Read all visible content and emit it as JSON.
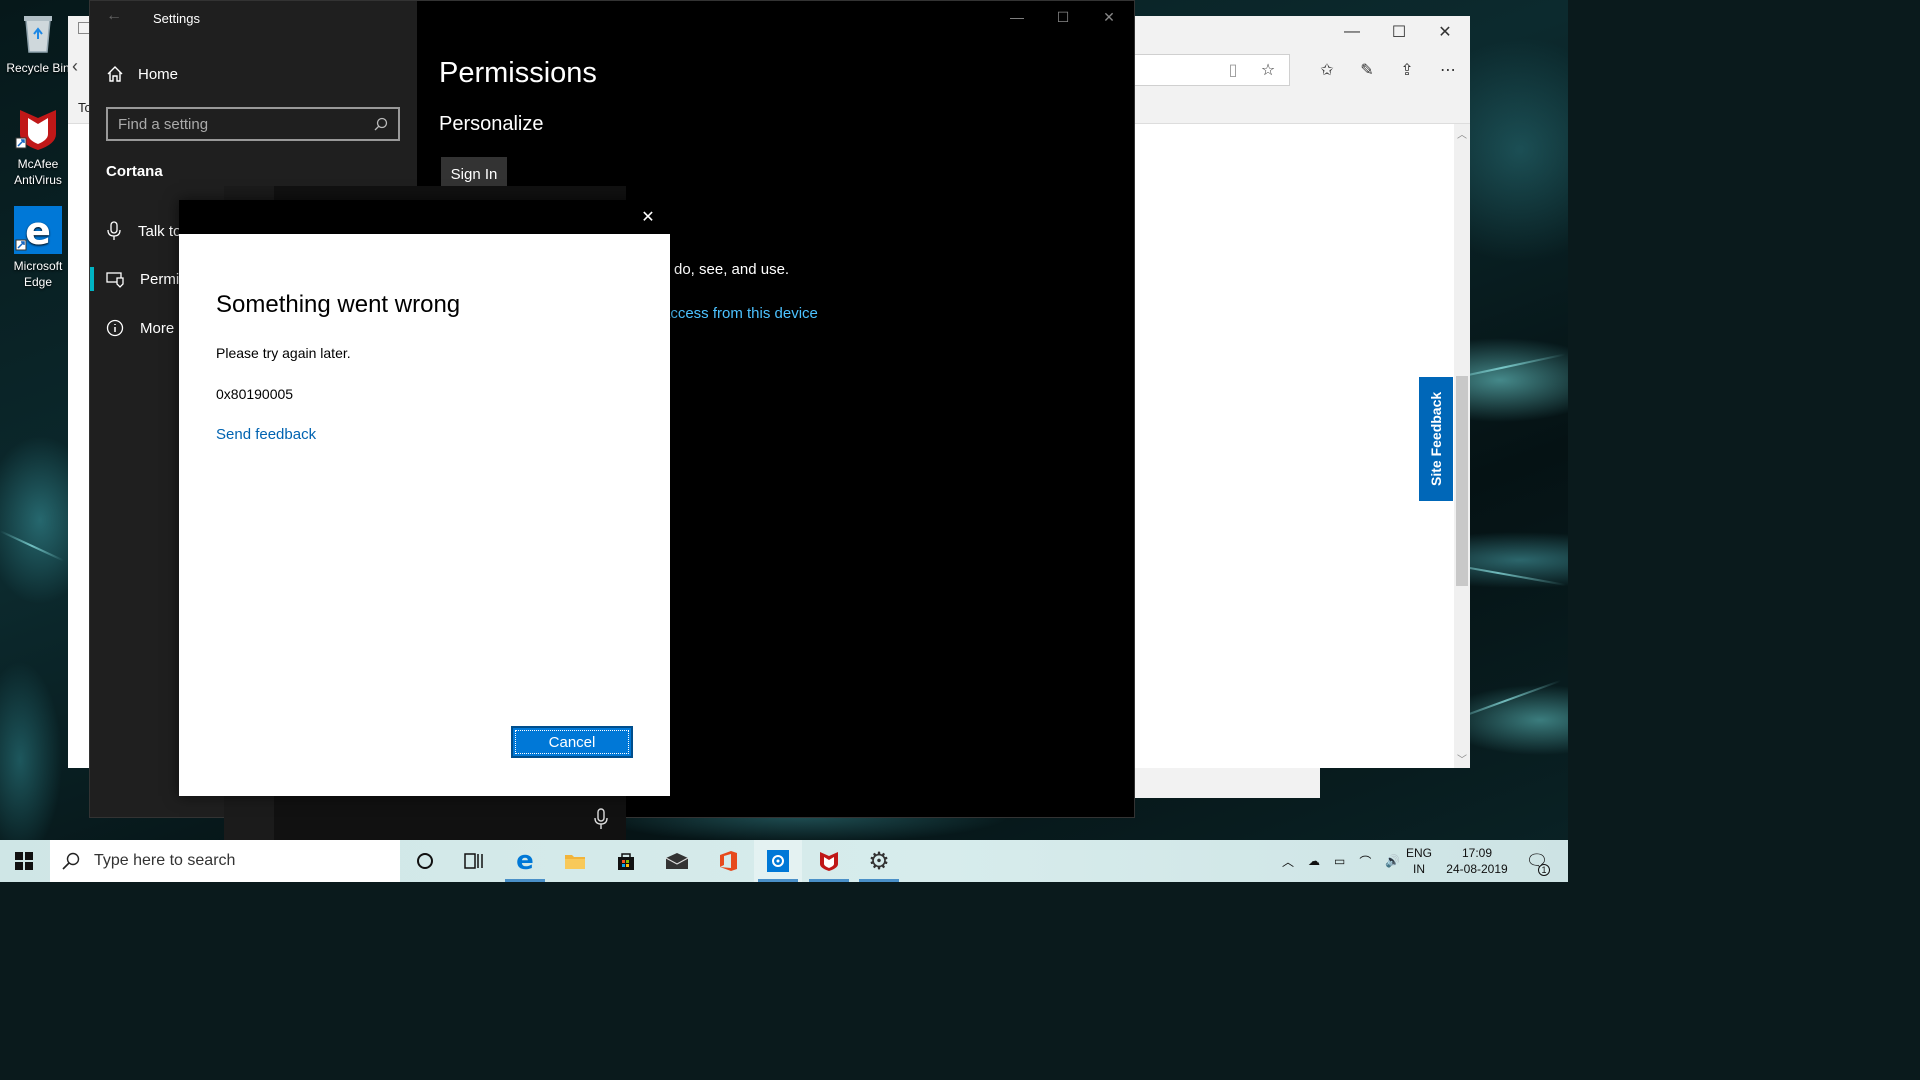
{
  "desktop": {
    "icons": [
      {
        "label": "Recycle Bin"
      },
      {
        "label": "McAfee AntiVirus"
      },
      {
        "label": "Microsoft Edge"
      }
    ]
  },
  "edge": {
    "tab_fragment": "To",
    "site_feedback": "Site Feedback"
  },
  "settings": {
    "title": "Settings",
    "nav": {
      "home": "Home",
      "search_placeholder": "Find a setting",
      "section": "Cortana",
      "items": [
        {
          "label": "Talk to"
        },
        {
          "label": "Permis"
        },
        {
          "label": "More c"
        }
      ]
    },
    "main": {
      "title": "Permissions",
      "subtitle": "Personalize",
      "sign_in": "Sign In",
      "text_fragment": "do, see, and use.",
      "link_fragment": "access from this device"
    }
  },
  "dialog": {
    "heading": "Something went wrong",
    "message": "Please try again later.",
    "error_code": "0x80190005",
    "feedback_link": "Send feedback",
    "cancel": "Cancel"
  },
  "taskbar": {
    "search_placeholder": "Type here to search",
    "language_top": "ENG",
    "language_bottom": "IN",
    "time": "17:09",
    "date": "24-08-2019",
    "notification_count": "1"
  },
  "colors": {
    "accent": "#0078d7",
    "link": "#0063b1",
    "teal_accent": "#00b4c4",
    "site_feedback_bg": "#0067b8"
  }
}
